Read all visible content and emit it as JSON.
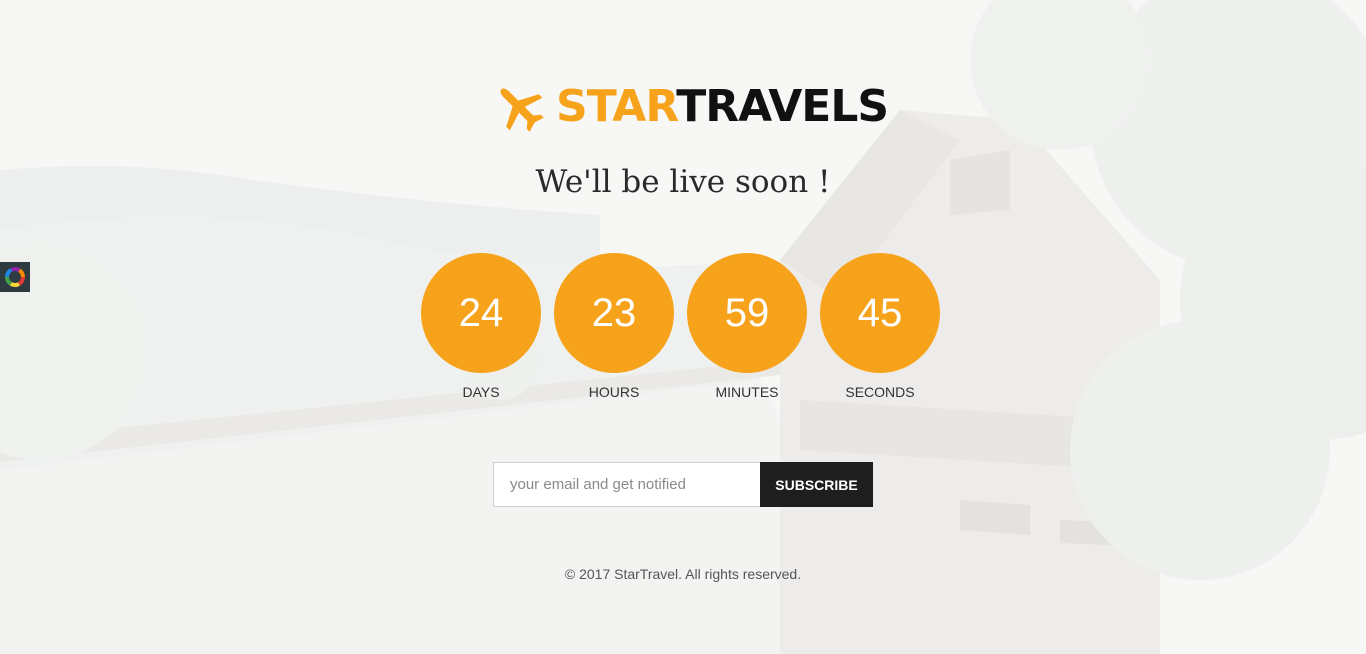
{
  "brand": {
    "name_part1": "STAR",
    "name_part2": "TRAVELS",
    "logo_icon": "airplane-icon"
  },
  "tagline": "We'll be live soon !",
  "countdown": [
    {
      "value": "24",
      "label": "DAYS"
    },
    {
      "value": "23",
      "label": "HOURS"
    },
    {
      "value": "59",
      "label": "MINUTES"
    },
    {
      "value": "45",
      "label": "SECONDS"
    }
  ],
  "subscribe": {
    "placeholder": "your email and get notified",
    "value": "",
    "button_label": "SUBSCRIBE"
  },
  "footer": {
    "copyright": "© 2017 StarTravel. All rights reserved."
  },
  "colors": {
    "accent": "#f7a21b",
    "dark": "#1e1e1e"
  },
  "side_widget": {
    "icon": "color-wheel-icon"
  }
}
